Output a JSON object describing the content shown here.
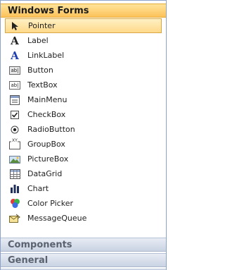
{
  "categories": {
    "windows_forms": "Windows Forms",
    "components": "Components",
    "general": "General"
  },
  "items": [
    {
      "label": "Pointer",
      "icon": "pointer-icon",
      "selected": true
    },
    {
      "label": "Label",
      "icon": "label-icon"
    },
    {
      "label": "LinkLabel",
      "icon": "linklabel-icon"
    },
    {
      "label": "Button",
      "icon": "button-icon"
    },
    {
      "label": "TextBox",
      "icon": "textbox-icon"
    },
    {
      "label": "MainMenu",
      "icon": "mainmenu-icon"
    },
    {
      "label": "CheckBox",
      "icon": "checkbox-icon"
    },
    {
      "label": "RadioButton",
      "icon": "radiobutton-icon"
    },
    {
      "label": "GroupBox",
      "icon": "groupbox-icon"
    },
    {
      "label": "PictureBox",
      "icon": "picturebox-icon"
    },
    {
      "label": "DataGrid",
      "icon": "datagrid-icon"
    },
    {
      "label": "Chart",
      "icon": "chart-icon"
    },
    {
      "label": "Color Picker",
      "icon": "color-picker-icon"
    },
    {
      "label": "MessageQueue",
      "icon": "messagequeue-icon"
    }
  ],
  "icon_glyphs": {
    "label": "A",
    "linklabel": "A",
    "button": "ab|",
    "textbox": "ab|",
    "groupbox": "XY"
  },
  "colors": {
    "selection": "#ffd98a",
    "active_header": "#fcc25a",
    "collapsed_header": "#c9d3e3"
  }
}
